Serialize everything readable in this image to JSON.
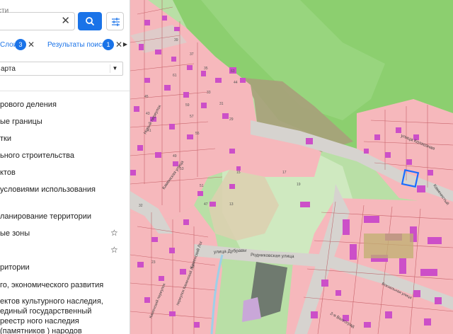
{
  "panel": {
    "search": {
      "placeholder": "сти"
    },
    "chips": {
      "layers_label": "Слои",
      "layers_count": "3",
      "results_label": "Результаты поиска",
      "results_count": "1"
    },
    "basemap_select": {
      "value": "арта"
    },
    "layers": [
      {
        "label": "рового деления"
      },
      {
        "label": "ые границы"
      },
      {
        "label": "тки"
      },
      {
        "label": "ьного строительства"
      },
      {
        "label": "ктов"
      },
      {
        "label": "условиями использования"
      },
      {
        "label": "ланирование территории"
      },
      {
        "label": "ые зоны"
      },
      {
        "label": "ритории"
      },
      {
        "label": "го, экономического развития"
      },
      {
        "label": "ектов культурного наследия, единый государственный реестр ного наследия (памятников ) народов Российской"
      }
    ]
  },
  "map": {
    "colors": {
      "residential_zone": "#f6b8bc",
      "forest": "#8ccf6f",
      "green_zone": "#c6e8b6",
      "roads": "#d6d3cf",
      "dark_zone": "#a7a07a",
      "building": "#cc4fc8",
      "selected_parcel": "#1a6cff"
    },
    "streets": [
      "Новый переулок",
      "Каменская улица",
      "улица Дубравы",
      "Родниковская улица",
      "улица Колхозная",
      "Каменистый",
      "Каменский Лог",
      "переулок Каменский Лог",
      "Каменский переулок",
      "2-я Волгоград",
      "Вокзальная улица"
    ],
    "house_numbers": [
      "45",
      "43",
      "41",
      "39",
      "37",
      "35",
      "33",
      "31",
      "29",
      "19",
      "17",
      "15",
      "13",
      "63",
      "61",
      "59",
      "57",
      "55",
      "53",
      "49",
      "51",
      "47",
      "44",
      "23",
      "32"
    ]
  }
}
